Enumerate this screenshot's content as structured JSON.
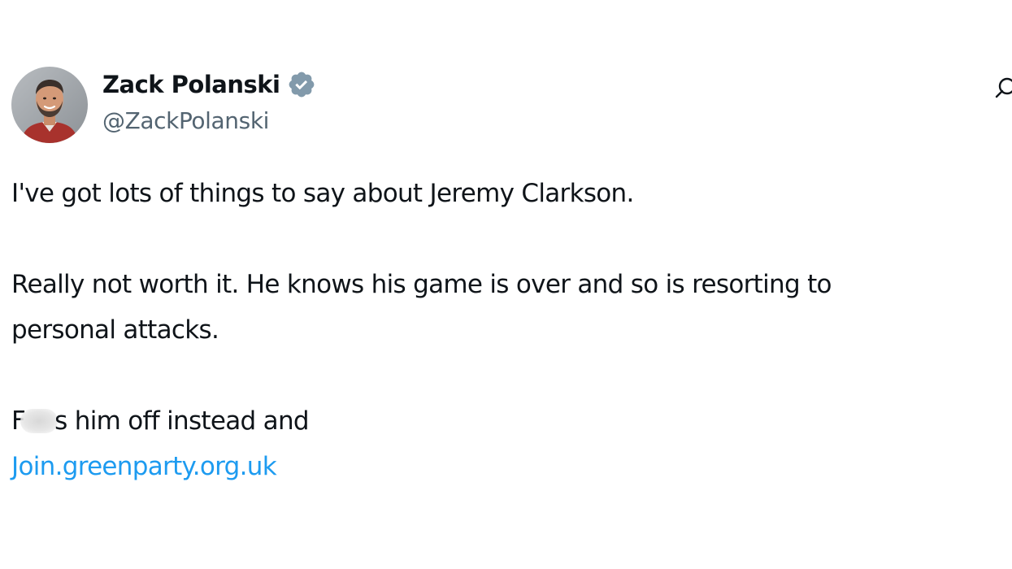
{
  "author": {
    "name": "Zack Polanski",
    "handle": "@ZackPolanski",
    "verified": true,
    "verified_badge_color": "#829aab",
    "avatar_icon": "profile-photo"
  },
  "header_icon": "grok-icon",
  "tweet": {
    "line1": "I've got lots of things to say about Jeremy Clarkson.",
    "para2_line1": "Really not worth it.  He knows his game is over and so is resorting to",
    "para2_line2": "personal attacks.",
    "para3_start": "F",
    "para3_mid": "s him off instead and",
    "link": "Join.greenparty.org.uk"
  },
  "colors": {
    "text": "#0f1419",
    "secondary": "#536471",
    "link": "#1d9bf0"
  }
}
